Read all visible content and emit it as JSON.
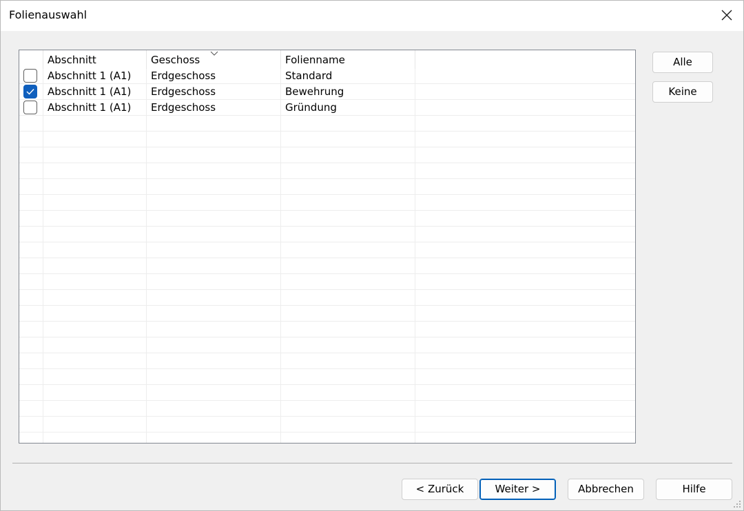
{
  "window": {
    "title": "Folienauswahl",
    "close_icon": "close-icon"
  },
  "table": {
    "columns": [
      "Abschnitt",
      "Geschoss",
      "Folienname"
    ],
    "sorted_column": "Geschoss",
    "rows": [
      {
        "checked": false,
        "abschnitt": "Abschnitt 1 (A1)",
        "geschoss": "Erdgeschoss",
        "folienname": "Standard"
      },
      {
        "checked": true,
        "abschnitt": "Abschnitt 1 (A1)",
        "geschoss": "Erdgeschoss",
        "folienname": "Bewehrung"
      },
      {
        "checked": false,
        "abschnitt": "Abschnitt 1 (A1)",
        "geschoss": "Erdgeschoss",
        "folienname": "Gründung"
      }
    ],
    "accent_color": "#0f5fbd"
  },
  "side_buttons": {
    "all_label": "Alle",
    "none_label": "Keine"
  },
  "footer": {
    "back_label": "< Zurück",
    "next_label": "Weiter >",
    "cancel_label": "Abbrechen",
    "help_label": "Hilfe"
  }
}
